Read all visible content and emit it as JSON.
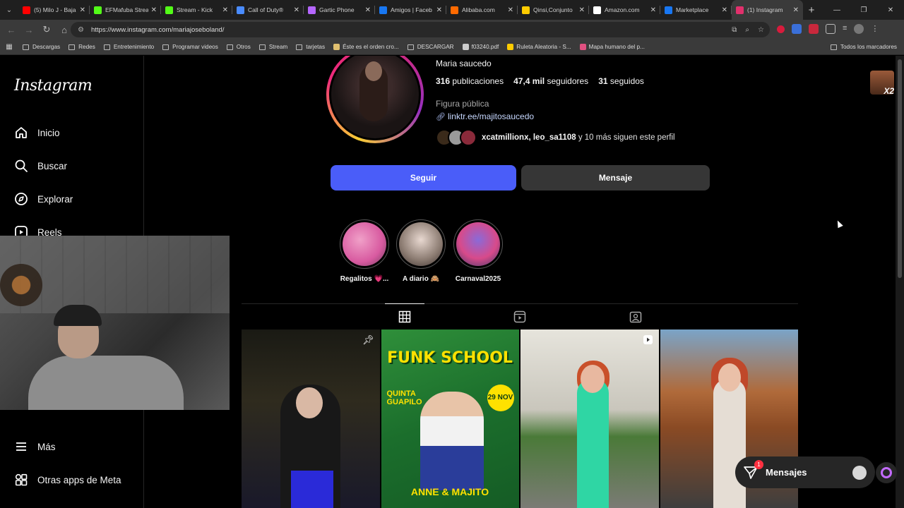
{
  "browser": {
    "tabs": [
      {
        "label": "(5) Milo J - Baja",
        "fav_color": "#ff0000"
      },
      {
        "label": "EFMafuba Stream",
        "fav_color": "#53fc18"
      },
      {
        "label": "Stream - Kick",
        "fav_color": "#53fc18"
      },
      {
        "label": "Call of Duty®",
        "fav_color": "#4a8cff"
      },
      {
        "label": "Gartic Phone",
        "fav_color": "#b566ff"
      },
      {
        "label": "Amigos | Faceb",
        "fav_color": "#1877f2"
      },
      {
        "label": "Alibaba.com",
        "fav_color": "#ff6a00"
      },
      {
        "label": "Qinsi,Conjunto",
        "fav_color": "#ffcc00"
      },
      {
        "label": "Amazon.com",
        "fav_color": "#ffffff"
      },
      {
        "label": "Marketplace",
        "fav_color": "#1877f2"
      },
      {
        "label": "(1) Instagram",
        "fav_color": "#e1306c"
      }
    ],
    "url": "https://www.instagram.com/mariajoseboland/",
    "bookmarks": [
      {
        "label": "Descargas",
        "type": "folder"
      },
      {
        "label": "Redes",
        "type": "folder"
      },
      {
        "label": "Entretenimiento",
        "type": "folder"
      },
      {
        "label": "Programar videos",
        "type": "folder"
      },
      {
        "label": "Otros",
        "type": "folder"
      },
      {
        "label": "Stream",
        "type": "folder"
      },
      {
        "label": "tarjetas",
        "type": "folder"
      },
      {
        "label": "Éste es el orden cro...",
        "type": "site",
        "color": "#e0c070"
      },
      {
        "label": "DESCARGAR",
        "type": "folder"
      },
      {
        "label": "f03240.pdf",
        "type": "site",
        "color": "#cccccc"
      },
      {
        "label": "Ruleta Aleatoria - S...",
        "type": "site",
        "color": "#ffcc00"
      },
      {
        "label": "Mapa humano del p...",
        "type": "site",
        "color": "#e05080"
      }
    ],
    "bookmarks_all": "Todos los marcadores"
  },
  "sidebar": {
    "logo": "Instagram",
    "items": [
      {
        "label": "Inicio",
        "icon": "home-icon"
      },
      {
        "label": "Buscar",
        "icon": "search-icon"
      },
      {
        "label": "Explorar",
        "icon": "compass-icon"
      },
      {
        "label": "Reels",
        "icon": "reels-icon"
      },
      {
        "label": "Más",
        "icon": "menu-icon"
      },
      {
        "label": "Otras apps de Meta",
        "icon": "apps-icon"
      }
    ]
  },
  "profile": {
    "full_name": "Maria saucedo",
    "posts_count": "316",
    "posts_label": "publicaciones",
    "followers_count": "47,4 mil",
    "followers_label": "seguidores",
    "following_count": "31",
    "following_label": "seguidos",
    "category": "Figura pública",
    "link": "linktr.ee/majitosaucedo",
    "followed_by_names": "xcatmillionx, leo_sa1108",
    "followed_by_rest": "y 10 más siguen este perfil",
    "follow_button": "Seguir",
    "message_button": "Mensaje"
  },
  "highlights": [
    {
      "label": "Regalitos 💗...",
      "color1": "#f0a0c8",
      "color2": "#d85aa0"
    },
    {
      "label": "A diario 🙈",
      "color1": "#e8d8d0",
      "color2": "#8a7a70"
    },
    {
      "label": "Carnaval2025",
      "color1": "#8a6ad8",
      "color2": "#d84a8a"
    }
  ],
  "posts": [
    {
      "kind": "pinned",
      "badge": "pin-icon"
    },
    {
      "kind": "image",
      "title": "FUNK SCHOOL",
      "subtitle": "QUINTA GUAPILO",
      "date": "29 NOV",
      "names": "ANNE & MAJITO"
    },
    {
      "kind": "reel",
      "badge": "reel-icon"
    },
    {
      "kind": "image"
    }
  ],
  "story_overlay": {
    "label": "X2"
  },
  "messages": {
    "label": "Mensajes",
    "badge": "1"
  }
}
